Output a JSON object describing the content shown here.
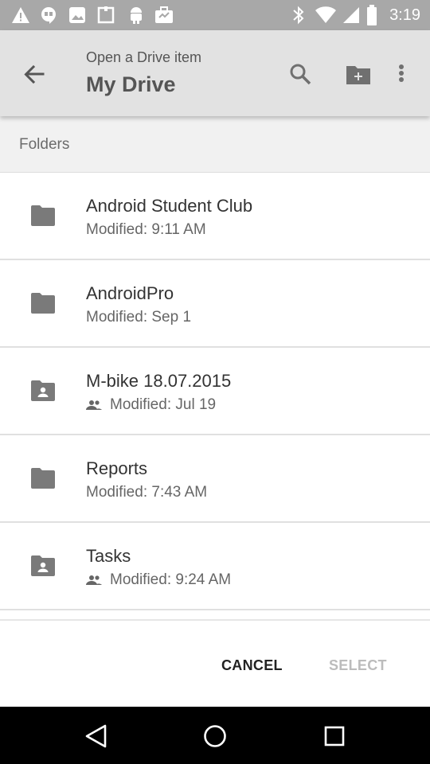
{
  "status_bar": {
    "time": "3:19",
    "left_icons": [
      "warning-icon",
      "hangouts-icon",
      "photos-icon",
      "image-icon",
      "android-icon",
      "briefcase-icon"
    ],
    "right_icons": [
      "bluetooth-icon",
      "wifi-icon",
      "signal-icon",
      "battery-icon"
    ]
  },
  "app_bar": {
    "subtitle": "Open a Drive item",
    "title": "My Drive",
    "actions": [
      "search-icon",
      "new-folder-icon",
      "more-vert-icon"
    ]
  },
  "section": {
    "label": "Folders"
  },
  "folders": [
    {
      "name": "Android Student Club",
      "modified": "Modified: 9:11 AM",
      "shared": false
    },
    {
      "name": "AndroidPro",
      "modified": "Modified: Sep 1",
      "shared": false
    },
    {
      "name": "M-bike 18.07.2015",
      "modified": "Modified: Jul 19",
      "shared": true
    },
    {
      "name": "Reports",
      "modified": "Modified: 7:43 AM",
      "shared": false
    },
    {
      "name": "Tasks",
      "modified": "Modified: 9:24 AM",
      "shared": true
    }
  ],
  "footer": {
    "cancel_label": "CANCEL",
    "select_label": "SELECT"
  },
  "colors": {
    "app_bar": "#e2e2e2",
    "status_bar": "#a8a8a8",
    "section_bg": "#f1f1f1",
    "icon_grey": "#7a7a7a",
    "disabled": "#bcbcbc"
  }
}
